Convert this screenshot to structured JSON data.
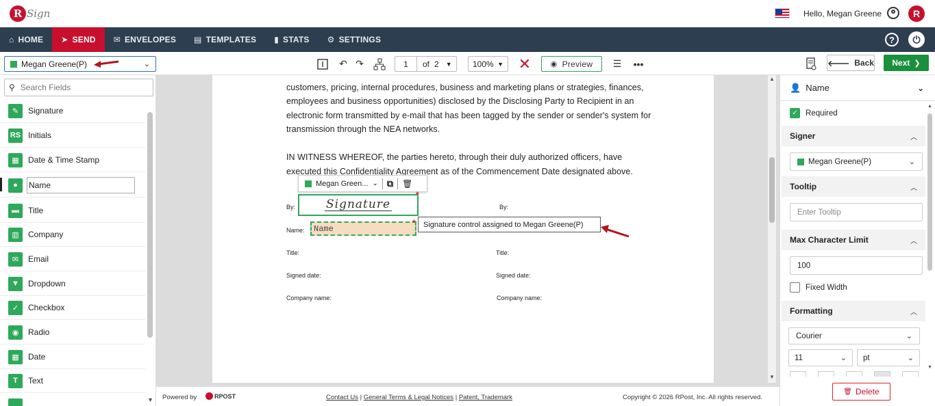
{
  "header": {
    "logo_letter": "R",
    "logo_text": "Sign",
    "greeting": "Hello, Megan Greene",
    "brand_letter": "R"
  },
  "nav": {
    "items": [
      {
        "icon": "⌂",
        "label": "HOME"
      },
      {
        "icon": "➤",
        "label": "SEND"
      },
      {
        "icon": "✉",
        "label": "ENVELOPES"
      },
      {
        "icon": "▤",
        "label": "TEMPLATES"
      },
      {
        "icon": "▮",
        "label": "STATS"
      },
      {
        "icon": "⚙",
        "label": "SETTINGS"
      }
    ],
    "active": "SEND",
    "help": "?",
    "power": "⏻"
  },
  "toolbar": {
    "signer": "Megan Greene(P)",
    "page_current": "1",
    "page_of": "of",
    "page_total": "2",
    "zoom": "100%",
    "preview": "Preview",
    "back": "Back",
    "next": "Next"
  },
  "fields": {
    "search_placeholder": "Search Fields",
    "items": [
      {
        "icon": "✎",
        "label": "Signature"
      },
      {
        "icon": "RS",
        "label": "Initials"
      },
      {
        "icon": "▦",
        "label": "Date & Time Stamp"
      },
      {
        "icon": "●",
        "label": "Name"
      },
      {
        "icon": "▬",
        "label": "Title"
      },
      {
        "icon": "▥",
        "label": "Company"
      },
      {
        "icon": "✉",
        "label": "Email"
      },
      {
        "icon": "▼",
        "label": "Dropdown"
      },
      {
        "icon": "✓",
        "label": "Checkbox"
      },
      {
        "icon": "◉",
        "label": "Radio"
      },
      {
        "icon": "▦",
        "label": "Date"
      },
      {
        "icon": "T",
        "label": "Text"
      }
    ],
    "selected": "Name"
  },
  "document": {
    "lines": [
      "customers, pricing, internal procedures, business and marketing plans or strategies, finances,",
      "employees and business opportunities) disclosed by the Disclosing Party to Recipient in an",
      "electronic form transmitted by e-mail that has been tagged by the sender or sender's system for",
      "transmission through the NEA networks.",
      "IN WITNESS WHEREOF, the parties hereto, through their duly authorized officers, have",
      "executed this Confidentiality Agreement as of the Commencement Date designated above."
    ],
    "labels": {
      "by1": "By:",
      "by2": "By:",
      "name": "Name:",
      "title1": "Title:",
      "title2": "Title:",
      "signed1": "Signed date:",
      "signed2": "Signed date:",
      "company1": "Company name:",
      "company2": "Company name:"
    },
    "control_signer": "Megan Green...",
    "signature_text": "Signature",
    "name_text": "Name",
    "tooltip": "Signature control assigned to Megan Greene(P)"
  },
  "footer": {
    "powered": "Powered by",
    "rpost": "RPOST",
    "contact": "Contact Us",
    "terms": "General Terms & Legal Notices",
    "patent": "Patent, Trademark",
    "copyright": "Copyright © 2026 RPost, Inc. All rights reserved."
  },
  "props": {
    "title": "Name",
    "required_label": "Required",
    "signer_section": "Signer",
    "signer_value": "Megan Greene(P)",
    "tooltip_section": "Tooltip",
    "tooltip_placeholder": "Enter Tooltip",
    "max_section": "Max Character Limit",
    "max_value": "100",
    "fixed_width": "Fixed Width",
    "formatting_section": "Formatting",
    "font": "Courier",
    "size": "11",
    "unit": "pt",
    "delete": "Delete"
  },
  "colors": {
    "nav_bg": "#2d3e50",
    "accent_red": "#c8102e",
    "signer_green": "#2ea85a",
    "next_green": "#1a8f3c"
  }
}
